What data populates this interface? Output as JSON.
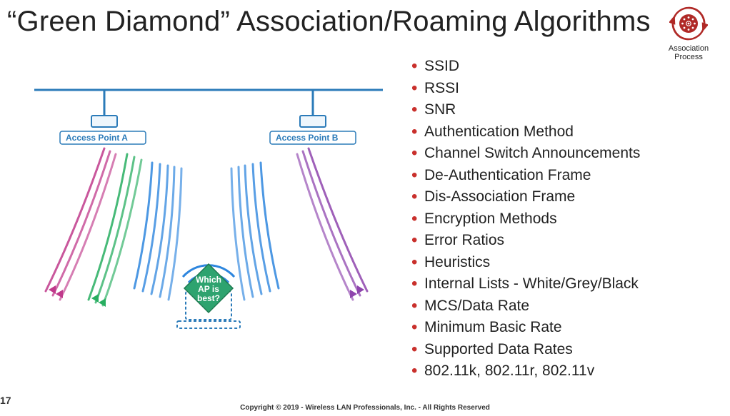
{
  "title": "“Green Diamond” Association/Roaming Algorithms",
  "badge": {
    "caption_line1": "Association",
    "caption_line2": "Process"
  },
  "diagram": {
    "ap_a_label": "Access Point A",
    "ap_b_label": "Access Point B",
    "callout_line1": "Which",
    "callout_line2": "AP is",
    "callout_line3": "best?"
  },
  "bullets": [
    "SSID",
    "RSSI",
    "SNR",
    "Authentication Method",
    "Channel Switch Announcements",
    "De-Authentication Frame",
    "Dis-Association Frame",
    "Encryption Methods",
    "Error Ratios",
    "Heuristics",
    "Internal Lists - White/Grey/Black",
    "MCS/Data Rate",
    "Minimum Basic Rate",
    "Supported Data Rates",
    "802.11k, 802.11r, 802.11v"
  ],
  "page_number": "17",
  "copyright": "Copyright © 2019 - Wireless LAN Professionals, Inc. - All Rights Reserved"
}
